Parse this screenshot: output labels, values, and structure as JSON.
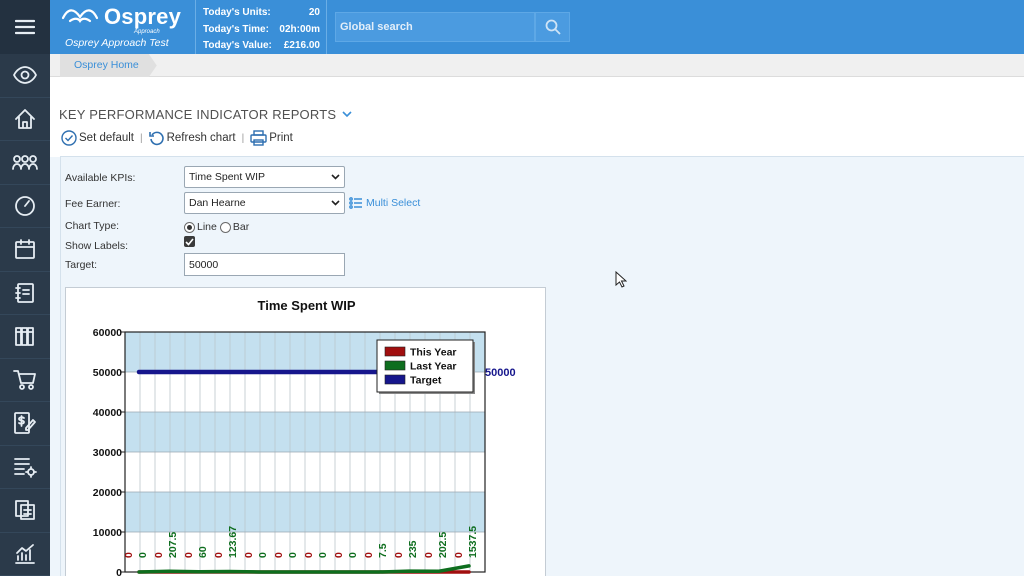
{
  "app": {
    "logo_text": "Osprey",
    "logo_sub": "Approach",
    "tenant": "Osprey Approach Test"
  },
  "stats": [
    {
      "label": "Today's Units:",
      "value": "20"
    },
    {
      "label": "Today's Time:",
      "value": "02h:00m"
    },
    {
      "label": "Today's Value:",
      "value": "£216.00"
    }
  ],
  "search": {
    "placeholder": "Global search"
  },
  "breadcrumb": {
    "home": "Osprey Home"
  },
  "page": {
    "title": "KEY PERFORMANCE INDICATOR REPORTS",
    "set_default": "Set default",
    "refresh": "Refresh chart",
    "print": "Print",
    "sep": "|"
  },
  "form": {
    "kpi_label": "Available KPIs:",
    "kpi_value": "Time Spent WIP",
    "fee_label": "Fee Earner:",
    "fee_value": "Dan Hearne",
    "multi_select": "Multi Select",
    "chart_type_label": "Chart Type:",
    "chart_type_line": "Line",
    "chart_type_bar": "Bar",
    "chart_type_selected": "Line",
    "show_labels_label": "Show Labels:",
    "show_labels": true,
    "target_label": "Target:",
    "target_value": "50000"
  },
  "chart_data": {
    "type": "line",
    "title": "Time Spent WIP",
    "xlabel": "",
    "ylabel": "",
    "ylim": [
      0,
      60000
    ],
    "yticks": [
      "60000",
      "50000",
      "40000",
      "30000",
      "20000",
      "10000",
      "0"
    ],
    "grid": true,
    "legend": "top-right",
    "x_count": 12,
    "series": [
      {
        "name": "This Year",
        "color": "#a10f0f",
        "values": [
          0,
          0,
          0,
          0,
          0,
          0,
          0,
          0,
          0,
          0,
          0,
          0
        ],
        "labels": [
          "0",
          "0",
          "0",
          "0",
          "0",
          "0",
          "0",
          "0",
          "0",
          "0",
          "0",
          "0"
        ]
      },
      {
        "name": "Last Year",
        "color": "#0e6e1e",
        "values": [
          0,
          207.5,
          60,
          123.67,
          0,
          0,
          0,
          0,
          7.5,
          235,
          202.5,
          1537.5
        ],
        "labels": [
          "0",
          "207.5",
          "60",
          "123.67",
          "0",
          "0",
          "0",
          "0",
          "7.5",
          "235",
          "202.5",
          "1537.5"
        ]
      },
      {
        "name": "Target",
        "color": "#16168c",
        "values": [
          50000,
          50000,
          50000,
          50000,
          50000,
          50000,
          50000,
          50000,
          50000,
          50000,
          50000,
          50000
        ],
        "end_label": "50000"
      }
    ]
  },
  "rail": {
    "icons": [
      "view-icon",
      "home-icon",
      "contacts-icon",
      "dashboard-icon",
      "calendar-icon",
      "notebook-icon",
      "library-icon",
      "cart-icon",
      "billing-icon",
      "settings-list-icon",
      "documents-icon",
      "reports-icon"
    ]
  }
}
